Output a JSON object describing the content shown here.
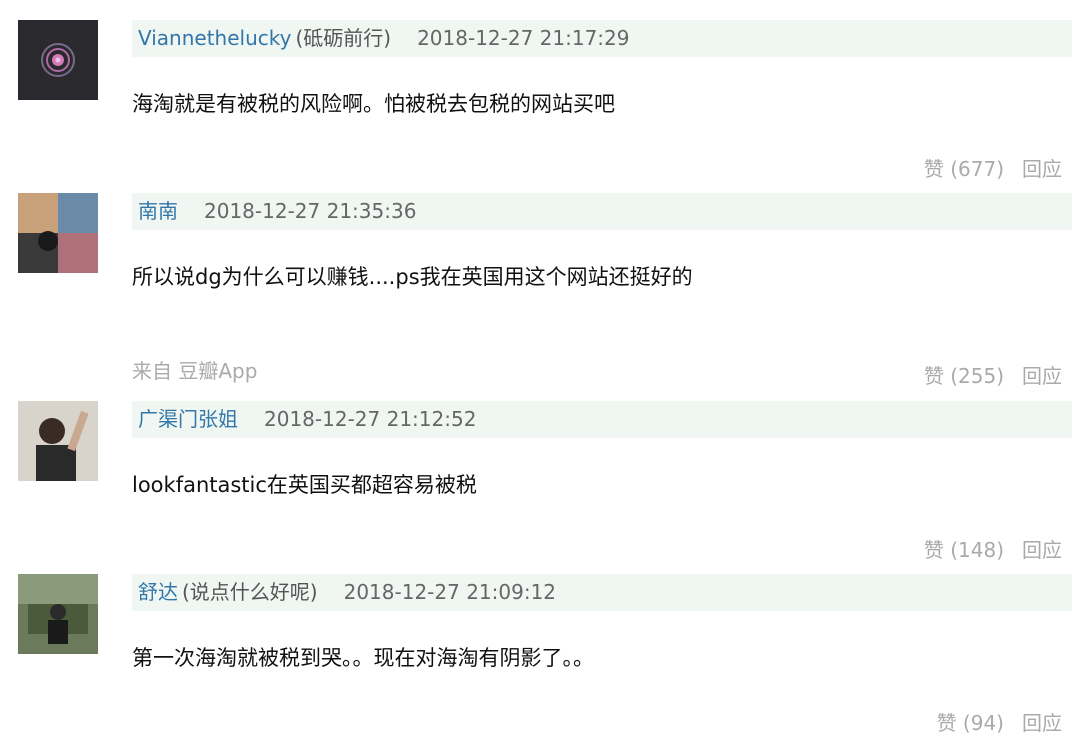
{
  "comments": [
    {
      "author": "Viannethelucky",
      "signature": "(砥砺前行)",
      "time": "2018-12-27 21:17:29",
      "content": "海淘就是有被税的风险啊。怕被税去包税的网站买吧",
      "source": "",
      "like_label": "赞 (677)",
      "reply_label": "回应"
    },
    {
      "author": "南南",
      "signature": "",
      "time": "2018-12-27 21:35:36",
      "content": "所以说dg为什么可以赚钱....ps我在英国用这个网站还挺好的",
      "source": "来自 豆瓣App",
      "like_label": "赞 (255)",
      "reply_label": "回应"
    },
    {
      "author": "广渠门张姐",
      "signature": "",
      "time": "2018-12-27 21:12:52",
      "content": "lookfantastic在英国买都超容易被税",
      "source": "",
      "like_label": "赞 (148)",
      "reply_label": "回应"
    },
    {
      "author": "舒达",
      "signature": "(说点什么好呢)",
      "time": "2018-12-27 21:09:12",
      "content": "第一次海淘就被税到哭。。现在对海淘有阴影了。。",
      "source": "",
      "like_label": "赞 (94)",
      "reply_label": "回应"
    }
  ],
  "colors": {
    "author_link": "#3377aa",
    "meta_bar_bg": "#f0f6f1",
    "muted_text": "#aaaaaa"
  }
}
